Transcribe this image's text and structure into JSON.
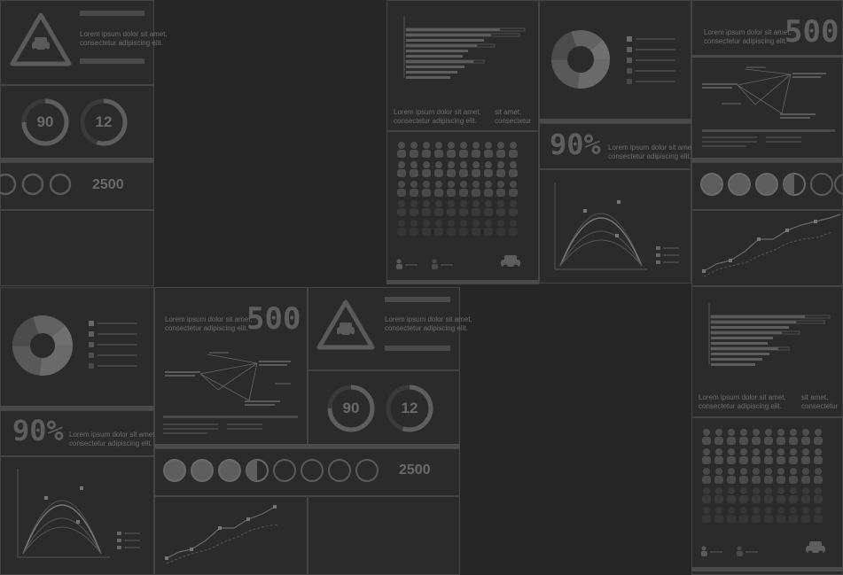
{
  "lorem_line1": "Lorem ipsum dolor sit amet,",
  "lorem_line2": "consectetur adipiscing elit.",
  "lorem_short1": "sit amet,",
  "lorem_short2": "consectetur",
  "gauges": [
    {
      "value": "90",
      "fraction": 0.75
    },
    {
      "value": "12",
      "fraction": 0.55
    }
  ],
  "counter_value": "2500",
  "big_number": "500",
  "percent": "90%",
  "colors": {
    "background": "#262626",
    "panel": "#2b2b2b",
    "mark": "#5a5a5a",
    "text": "#6e6e6e"
  },
  "icons": [
    "warning-triangle-car-icon",
    "person-icon",
    "car-icon"
  ]
}
